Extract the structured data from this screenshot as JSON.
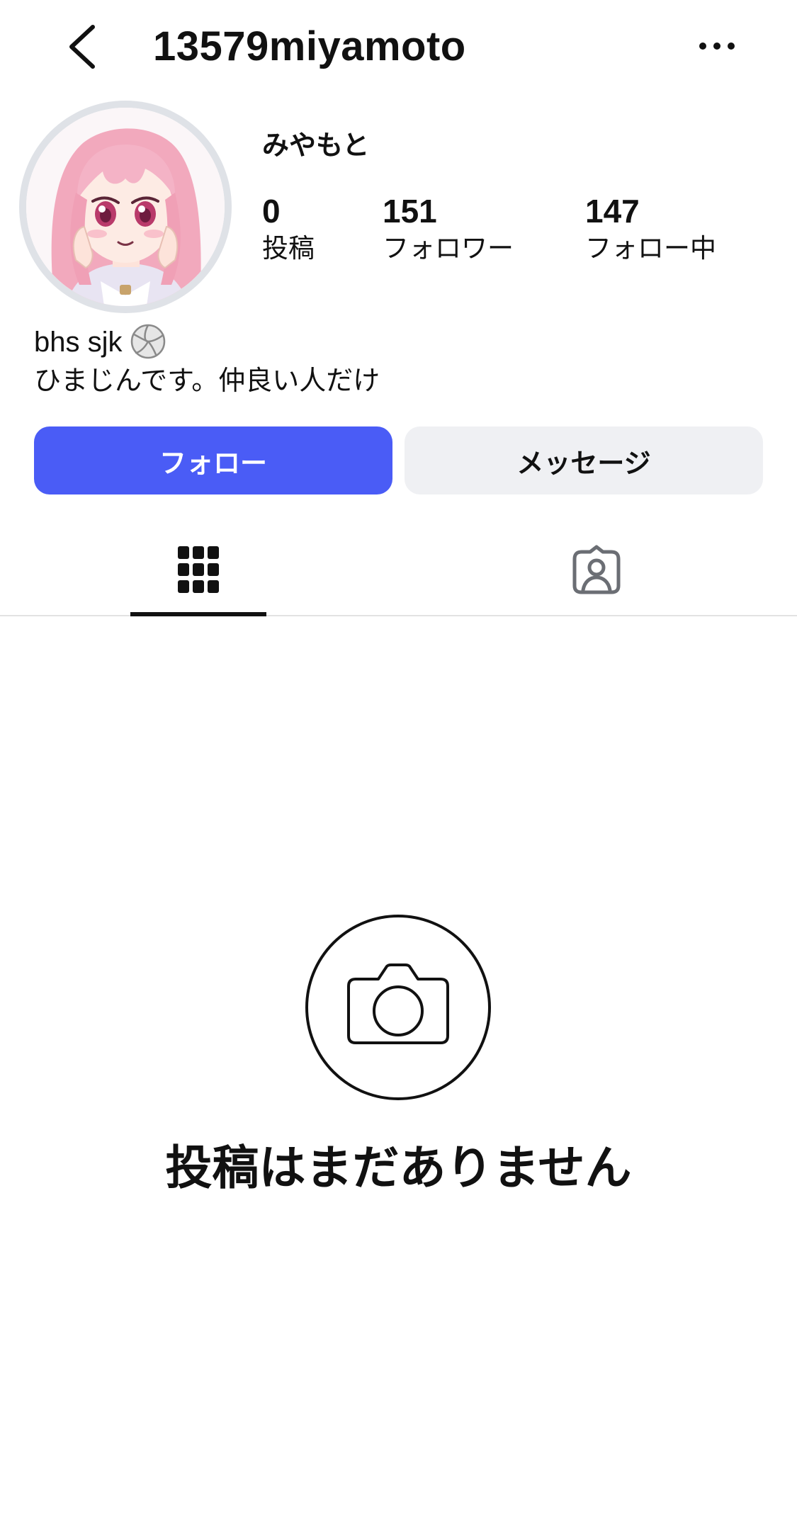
{
  "header": {
    "username": "13579miyamoto",
    "back_icon": "chevron-left-icon",
    "more_icon": "ellipsis-icon"
  },
  "profile": {
    "display_name": "みやもと",
    "avatar": "anime-girl-avatar",
    "stats": {
      "posts": {
        "value": "0",
        "label": "投稿"
      },
      "followers": {
        "value": "151",
        "label": "フォロワー"
      },
      "following": {
        "value": "147",
        "label": "フォロー中"
      }
    },
    "bio": {
      "line1": "bhs sjk",
      "line1_emoji": "volleyball-icon",
      "line2": "ひまじんです。仲良い人だけ"
    }
  },
  "actions": {
    "follow_label": "フォロー",
    "message_label": "メッセージ"
  },
  "tabs": {
    "items": [
      {
        "icon": "grid-icon",
        "active": true
      },
      {
        "icon": "tagged-person-icon",
        "active": false
      }
    ]
  },
  "empty_state": {
    "icon": "camera-icon",
    "message": "投稿はまだありません"
  },
  "colors": {
    "follow_button": "#4a5cf6",
    "message_button": "#eff0f3",
    "avatar_ring": "#dfe2e7",
    "text": "#111111"
  }
}
